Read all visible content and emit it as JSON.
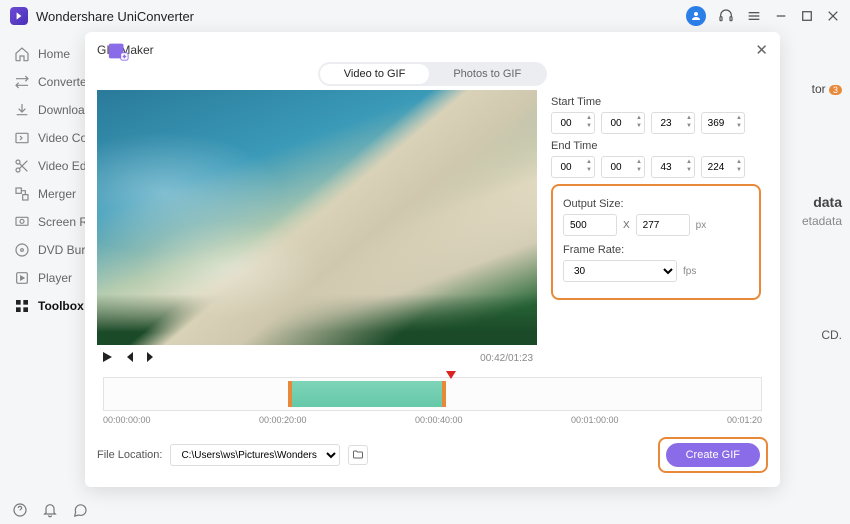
{
  "app": {
    "title": "Wondershare UniConverter"
  },
  "sidebar": {
    "items": [
      {
        "icon": "home",
        "label": "Home"
      },
      {
        "icon": "converter",
        "label": "Converter"
      },
      {
        "icon": "download",
        "label": "Downloader"
      },
      {
        "icon": "compress",
        "label": "Video Compressor"
      },
      {
        "icon": "editor",
        "label": "Video Editor"
      },
      {
        "icon": "merger",
        "label": "Merger"
      },
      {
        "icon": "recorder",
        "label": "Screen Recorder"
      },
      {
        "icon": "dvd",
        "label": "DVD Burner"
      },
      {
        "icon": "player",
        "label": "Player"
      },
      {
        "icon": "toolbox",
        "label": "Toolbox"
      }
    ]
  },
  "modal": {
    "title": "GIF Maker",
    "tabs": {
      "video": "Video to GIF",
      "photos": "Photos to GIF"
    },
    "time": {
      "start_label": "Start Time",
      "end_label": "End Time",
      "start": {
        "h": "00",
        "m": "00",
        "s": "23",
        "ms": "369"
      },
      "end": {
        "h": "00",
        "m": "00",
        "s": "43",
        "ms": "224"
      }
    },
    "output": {
      "size_label": "Output Size:",
      "w": "500",
      "h": "277",
      "x": "X",
      "unit": "px",
      "rate_label": "Frame Rate:",
      "rate": "30",
      "rate_unit": "fps"
    },
    "timecode": "00:42/01:23",
    "timeline": {
      "labels": [
        "00:00:00:00",
        "00:00:20:00",
        "00:00:40:00",
        "00:01:00:00",
        "00:01:20"
      ]
    },
    "file": {
      "label": "File Location:",
      "path": "C:\\Users\\ws\\Pictures\\Wonders"
    },
    "create": "Create GIF"
  },
  "bg": {
    "tor": "tor",
    "badge": "3",
    "data": "data",
    "etadata": "etadata",
    "cd": "CD."
  }
}
